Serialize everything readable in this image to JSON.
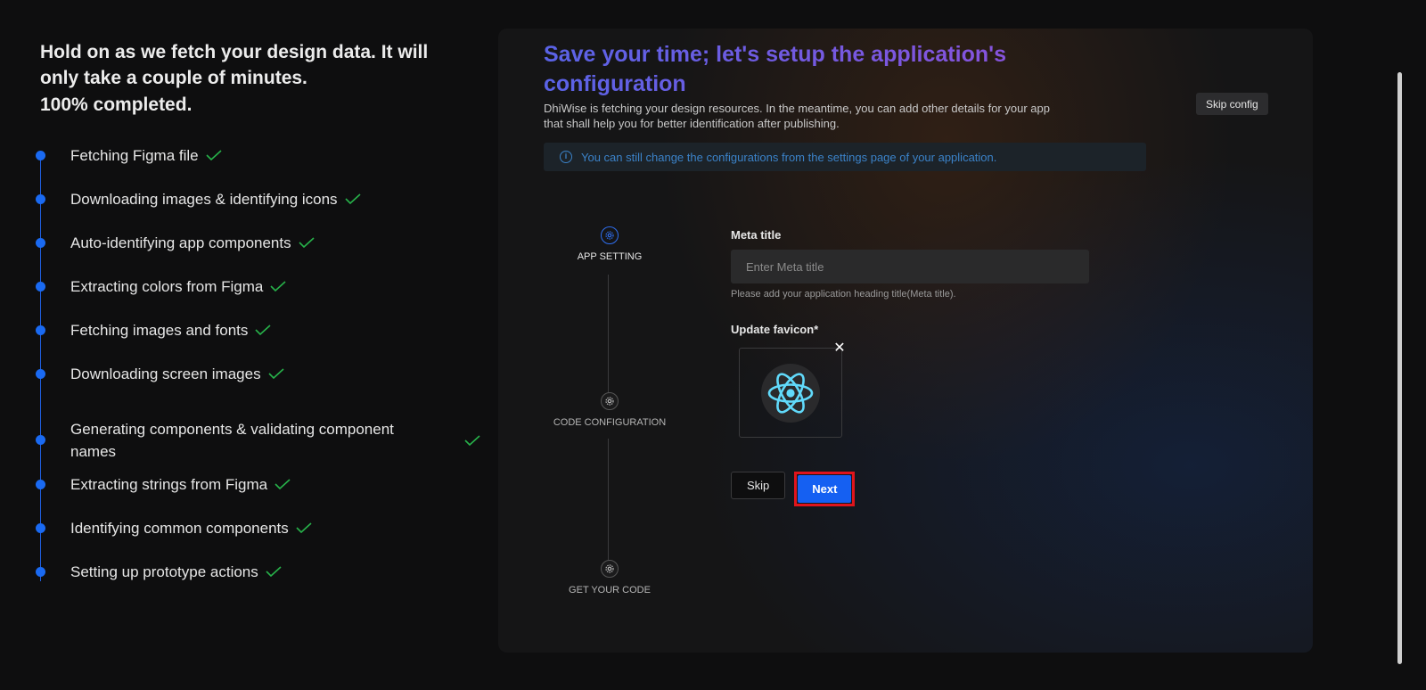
{
  "progress": {
    "heading": "Hold on as we fetch your design data. It will only take a couple of minutes.",
    "status": "100% completed.",
    "steps": [
      "Fetching Figma file",
      "Downloading images & identifying icons",
      "Auto-identifying app components",
      "Extracting colors from Figma",
      "Fetching images and fonts",
      "Downloading screen images",
      "Generating components & validating component names",
      "Extracting strings from Figma",
      "Identifying common components",
      "Setting up prototype actions"
    ]
  },
  "config": {
    "title": "Save your time; let's setup the application's configuration",
    "subtitle": "DhiWise is fetching your design resources. In the meantime, you can add other details for your app that shall help you for better identification after publishing.",
    "skip_config_label": "Skip config",
    "info_text": "You can still change the configurations from the settings page of your application.",
    "stepper": [
      "APP SETTING",
      "CODE CONFIGURATION",
      "GET YOUR CODE"
    ],
    "meta_title_label": "Meta title",
    "meta_title_placeholder": "Enter Meta title",
    "meta_title_value": "",
    "meta_title_hint": "Please add your application heading title(Meta title).",
    "favicon_label": "Update favicon*",
    "skip_label": "Skip",
    "next_label": "Next"
  },
  "colors": {
    "accent": "#1560f2",
    "check": "#27b24a",
    "title_gradient": [
      "#5a63e6",
      "#8a52dc"
    ],
    "highlight_border": "#e0141c"
  },
  "icons": [
    "check-icon",
    "info-icon",
    "gear-icon",
    "react-logo-icon",
    "close-icon"
  ]
}
